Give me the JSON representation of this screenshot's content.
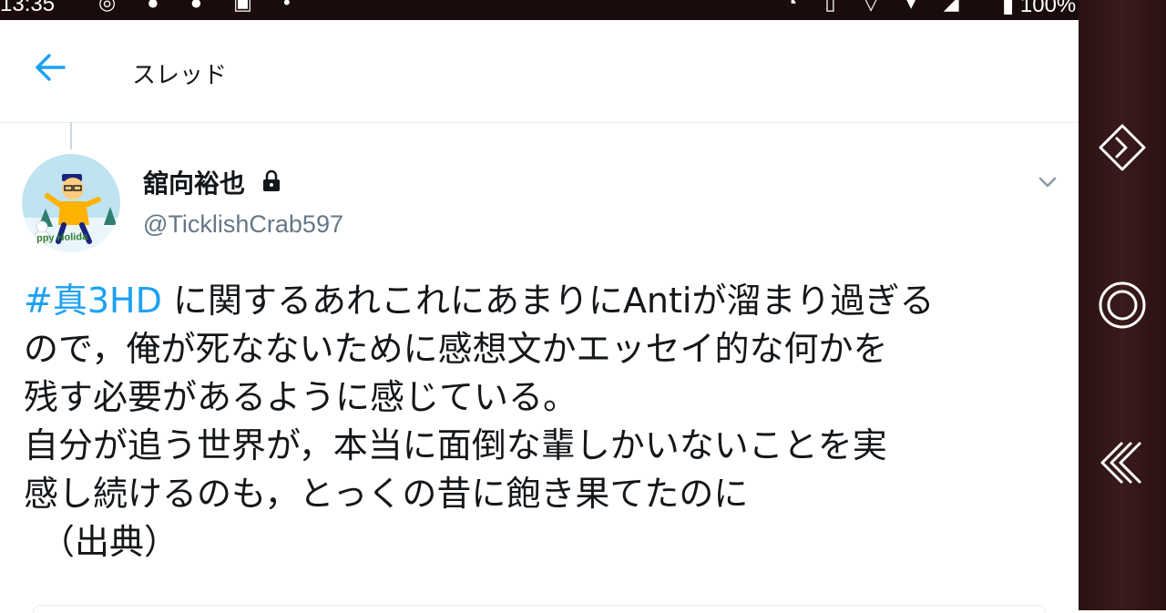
{
  "status_bar": {
    "time": "13:35",
    "left_icons": "◎ ● ● ▣ •",
    "right_icons": "◔ ▯ ▽ ▾ ◢",
    "battery": "▮ 100%"
  },
  "app_bar": {
    "title": "スレッド"
  },
  "tweet": {
    "display_name": "舘向裕也",
    "handle": "@TicklishCrab597",
    "avatar_caption": "ppy Holida",
    "hashtag": "#真3HD",
    "line1_rest": " に関するあれこれにあまりにAntiが溜まり過ぎる",
    "line2": "ので，俺が死なないために感想文かエッセイ的な何かを",
    "line3": "残す必要があるように感じている。",
    "line4": "自分が追う世界が，本当に面倒な輩しかいないことを実",
    "line5": "感し続けるのも，とっくの昔に飽き果てたのに",
    "line6": "（出典）"
  },
  "colors": {
    "accent": "#1da1f2",
    "text": "#14171a",
    "secondary_text": "#657786",
    "nav_bar": "#2a1212",
    "status_bar": "#1a0c0c"
  },
  "icons": {
    "back": "arrow-left-icon",
    "lock": "lock-icon",
    "more": "chevron-down-icon",
    "nav": [
      "nav-forward-icon",
      "nav-home-icon",
      "nav-back-icon"
    ]
  }
}
